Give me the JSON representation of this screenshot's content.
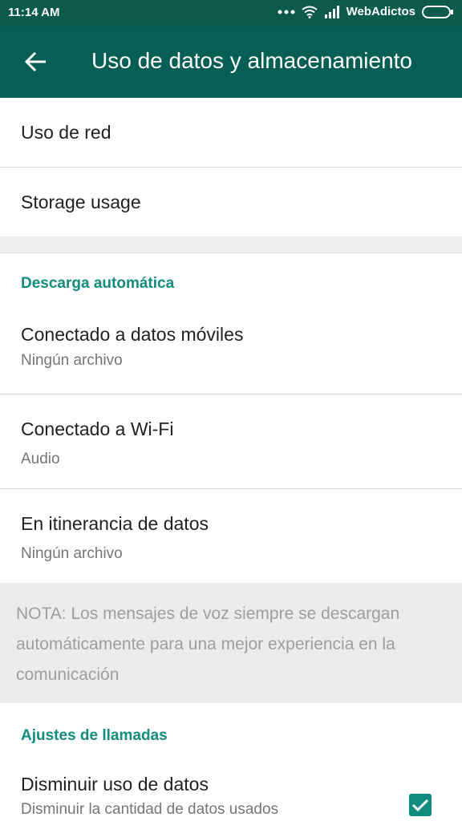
{
  "status_bar": {
    "time": "11:14 AM",
    "carrier": "WebAdictos",
    "icons": [
      "dots-icon",
      "wifi-icon",
      "signal-icon",
      "battery-icon"
    ]
  },
  "app_bar": {
    "title": "Uso de datos y almacenamiento",
    "back_icon": "arrow-left-icon",
    "color": "#075e54"
  },
  "items": {
    "network_usage": "Uso de red",
    "storage_usage": "Storage usage"
  },
  "auto_download": {
    "header": "Descarga automática",
    "mobile": {
      "title": "Conectado a datos móviles",
      "value": "Ningún archivo"
    },
    "wifi": {
      "title": "Conectado a Wi-Fi",
      "value": "Audio"
    },
    "roaming": {
      "title": "En itinerancia de datos",
      "value": "Ningún archivo"
    }
  },
  "note": "NOTA: Los mensajes de voz siempre se descargan automáticamente para una mejor experiencia en la comunicación",
  "call_settings": {
    "header": "Ajustes de llamadas",
    "low_data": {
      "title": "Disminuir uso de datos",
      "subtitle": "Disminuir la cantidad de datos usados",
      "checked": true
    }
  },
  "colors": {
    "accent": "#128c7e",
    "status_bar": "#0b5a4b"
  }
}
